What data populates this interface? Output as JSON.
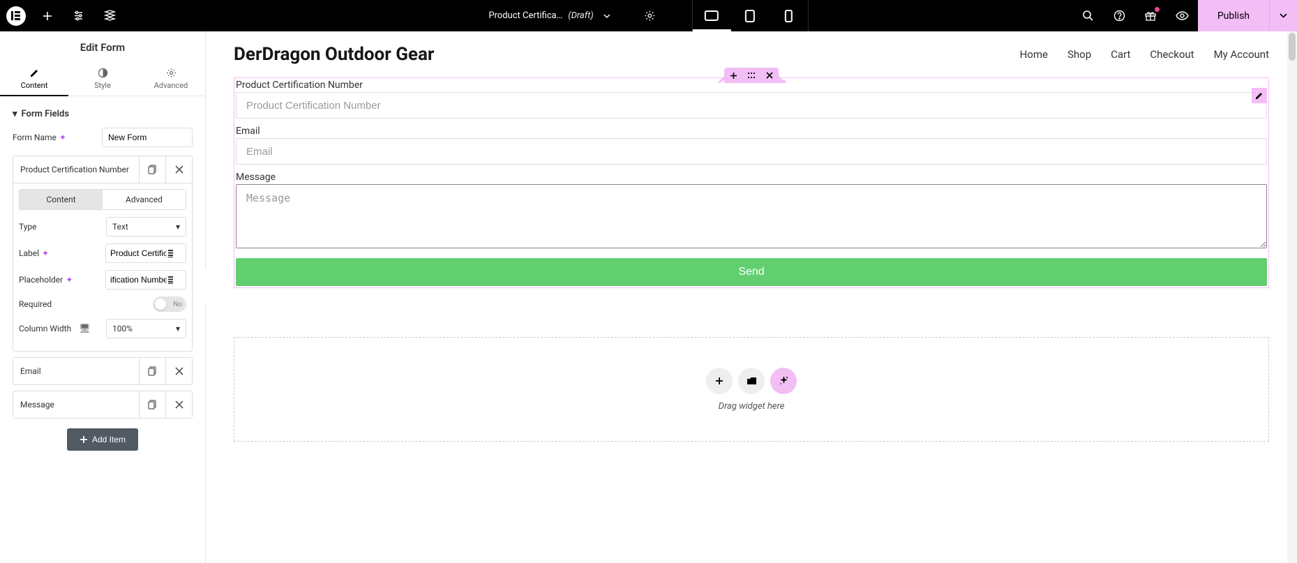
{
  "topbar": {
    "doc_title": "Product Certifica…",
    "doc_status": "(Draft)",
    "publish_label": "Publish"
  },
  "sidebar": {
    "title": "Edit Form",
    "tabs": {
      "content": "Content",
      "style": "Style",
      "advanced": "Advanced"
    },
    "section_title": "Form Fields",
    "form_name_label": "Form Name",
    "form_name_value": "New Form",
    "fields": [
      {
        "title": "Product Certification Number"
      },
      {
        "title": "Email"
      },
      {
        "title": "Message"
      }
    ],
    "field_editor": {
      "tabs": {
        "content": "Content",
        "advanced": "Advanced"
      },
      "type_label": "Type",
      "type_value": "Text",
      "label_label": "Label",
      "label_value": "Product Certifica",
      "placeholder_label": "Placeholder",
      "placeholder_value": "ification Number",
      "required_label": "Required",
      "required_value": "No",
      "colwidth_label": "Column Width",
      "colwidth_value": "100%"
    },
    "add_item_label": "Add Item"
  },
  "page": {
    "site_title": "DerDragon Outdoor Gear",
    "nav": [
      "Home",
      "Shop",
      "Cart",
      "Checkout",
      "My Account"
    ]
  },
  "form": {
    "fields": [
      {
        "label": "Product Certification Number",
        "placeholder": "Product Certification Number",
        "type": "text"
      },
      {
        "label": "Email",
        "placeholder": "Email",
        "type": "text"
      },
      {
        "label": "Message",
        "placeholder": "Message",
        "type": "textarea"
      }
    ],
    "submit_label": "Send"
  },
  "dropzone": {
    "text": "Drag widget here"
  }
}
